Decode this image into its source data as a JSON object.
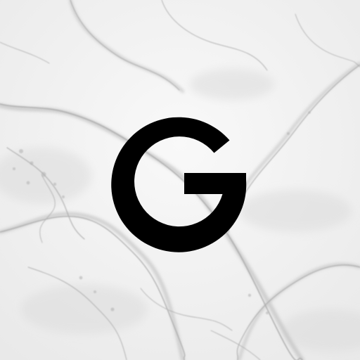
{
  "app_icon": {
    "logo_letter": "G",
    "logo_color": "#000000",
    "background": "marble-texture",
    "background_base_color": "#f3f3f3",
    "vein_color": "#b9b9b9"
  }
}
